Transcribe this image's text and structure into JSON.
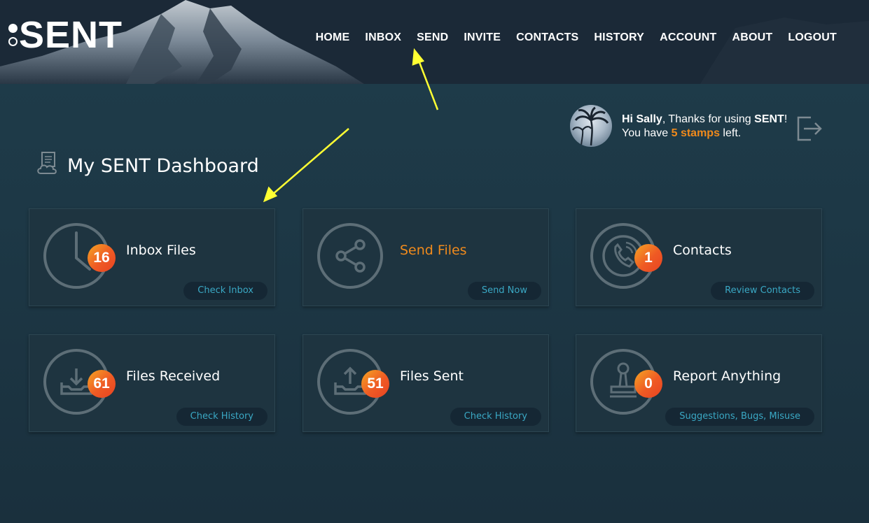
{
  "logo": {
    "text": "SENT"
  },
  "nav": {
    "items": [
      {
        "label": "HOME"
      },
      {
        "label": "INBOX"
      },
      {
        "label": "SEND"
      },
      {
        "label": "INVITE"
      },
      {
        "label": "CONTACTS"
      },
      {
        "label": "HISTORY"
      },
      {
        "label": "ACCOUNT"
      },
      {
        "label": "ABOUT"
      },
      {
        "label": "LOGOUT"
      }
    ]
  },
  "user": {
    "hi": "Hi Sally",
    "thanks": ", Thanks for using ",
    "brand": "SENT",
    "bang": "!",
    "you_have": "You have ",
    "stamps": "5 stamps",
    "left": " left."
  },
  "dashboard": {
    "title": "My SENT Dashboard",
    "cards": [
      {
        "label": "Inbox Files",
        "badge": "16",
        "action": "Check Inbox",
        "icon": "clock-icon"
      },
      {
        "label": "Send Files",
        "badge": "",
        "action": "Send Now",
        "icon": "share-icon"
      },
      {
        "label": "Contacts",
        "badge": "1",
        "action": "Review Contacts",
        "icon": "phone-icon"
      },
      {
        "label": "Files Received",
        "badge": "61",
        "action": "Check History",
        "icon": "download-tray-icon"
      },
      {
        "label": "Files Sent",
        "badge": "51",
        "action": "Check History",
        "icon": "upload-tray-icon"
      },
      {
        "label": "Report Anything",
        "badge": "0",
        "action": "Suggestions, Bugs, Misuse",
        "icon": "stamp-icon"
      }
    ]
  },
  "colors": {
    "accent": "#f08a1c",
    "link": "#3aa8c4",
    "background": "#1d3846",
    "card": "#1e3440",
    "annotation_arrow": "#ffff33"
  }
}
